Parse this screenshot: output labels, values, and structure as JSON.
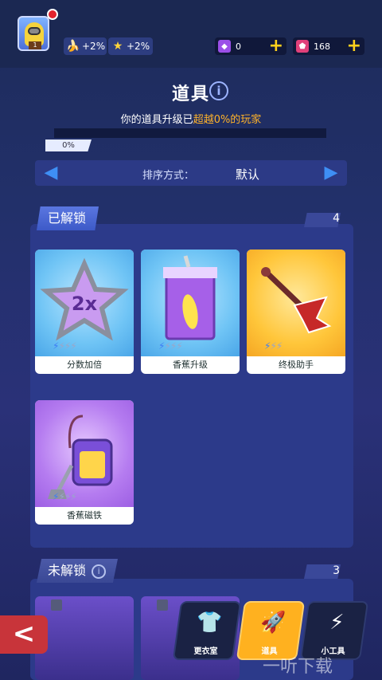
{
  "player": {
    "level": "1"
  },
  "bonuses": [
    {
      "icon": "banana-icon",
      "value": "+2%"
    },
    {
      "icon": "star-icon",
      "value": "+2%"
    }
  ],
  "currencies": [
    {
      "icon": "purple-gem-icon",
      "value": "0"
    },
    {
      "icon": "pink-token-icon",
      "value": "168"
    }
  ],
  "header": {
    "title": "道具",
    "subtitle_prefix": "你的道具升级已",
    "subtitle_highlight": "超越0%的玩家",
    "progress_label": "0%",
    "progress_fraction": 0
  },
  "sort": {
    "label": "排序方式：",
    "value": "默认"
  },
  "unlocked": {
    "label": "已解锁",
    "count": "4",
    "items": [
      {
        "name": "分数加倍",
        "bolts_on": 1,
        "bolts_total": 4
      },
      {
        "name": "香蕉升级",
        "bolts_on": 1,
        "bolts_total": 4
      },
      {
        "name": "终极助手",
        "bolts_on": 1,
        "bolts_total": 3
      },
      {
        "name": "香蕉磁铁",
        "bolts_on": 1,
        "bolts_total": 4
      }
    ]
  },
  "locked": {
    "label": "未解锁",
    "count": "3"
  },
  "nav": [
    {
      "label": "更衣室",
      "icon": "wardrobe-icon",
      "active": false
    },
    {
      "label": "道具",
      "icon": "rocket-icon",
      "active": true
    },
    {
      "label": "小工具",
      "icon": "gadget-icon",
      "active": false
    }
  ],
  "watermark": "一听下载",
  "colors": {
    "accent": "#ffb11f",
    "highlight": "#ffb32a",
    "bolt_on": "#3d7df5"
  }
}
